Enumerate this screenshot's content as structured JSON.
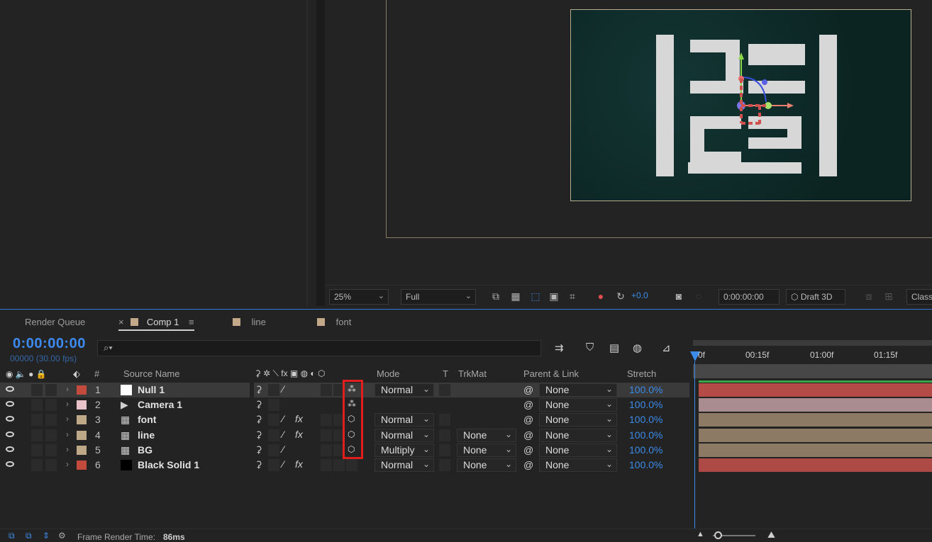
{
  "viewer": {
    "zoom": "25%",
    "resolution": "Full",
    "exposure": "+0.0",
    "timecode": "0:00:00:00",
    "renderer": "Draft 3D",
    "view_mode": "Class"
  },
  "tabs": [
    {
      "label": "Render Queue"
    },
    {
      "label": "Comp 1",
      "close": "×",
      "menu": "≡"
    },
    {
      "label": "line"
    },
    {
      "label": "font"
    }
  ],
  "timeline": {
    "time": "0:00:00:00",
    "fps": "00000 (30.00 fps)",
    "search_icon": "⌕▾",
    "ruler": [
      "0f",
      "00:15f",
      "01:00f",
      "01:15f"
    ]
  },
  "headers": {
    "hash": "#",
    "source_name": "Source Name",
    "mode": "Mode",
    "t": "T",
    "trkmat": "TrkMat",
    "parent": "Parent & Link",
    "stretch": "Stretch"
  },
  "layers": [
    {
      "num": "1",
      "name": "Null 1",
      "label_color": "#c44a3d",
      "mode": "Normal",
      "trkmat": "",
      "parent": "None",
      "stretch": "100.0%",
      "bar_color": "#b44b46"
    },
    {
      "num": "2",
      "name": "Camera 1",
      "label_color": "#e8c1c9",
      "mode": "",
      "trkmat": "",
      "parent": "None",
      "stretch": "100.0%",
      "bar_color": "#a88c90"
    },
    {
      "num": "3",
      "name": "font",
      "label_color": "#bda888",
      "mode": "Normal",
      "trkmat": "",
      "parent": "None",
      "stretch": "100.0%",
      "bar_color": "#8c7a64"
    },
    {
      "num": "4",
      "name": "line",
      "label_color": "#bda888",
      "mode": "Normal",
      "trkmat": "None",
      "parent": "None",
      "stretch": "100.0%",
      "bar_color": "#8c7a64"
    },
    {
      "num": "5",
      "name": "BG",
      "label_color": "#bda888",
      "mode": "Multiply",
      "trkmat": "None",
      "parent": "None",
      "stretch": "100.0%",
      "bar_color": "#8c7a64"
    },
    {
      "num": "6",
      "name": "Black Solid 1",
      "label_color": "#c44a3d",
      "mode": "Normal",
      "trkmat": "None",
      "parent": "None",
      "stretch": "100.0%",
      "bar_color": "#ad4a45"
    }
  ],
  "status": {
    "label": "Frame Render Time:",
    "value": "86ms"
  }
}
